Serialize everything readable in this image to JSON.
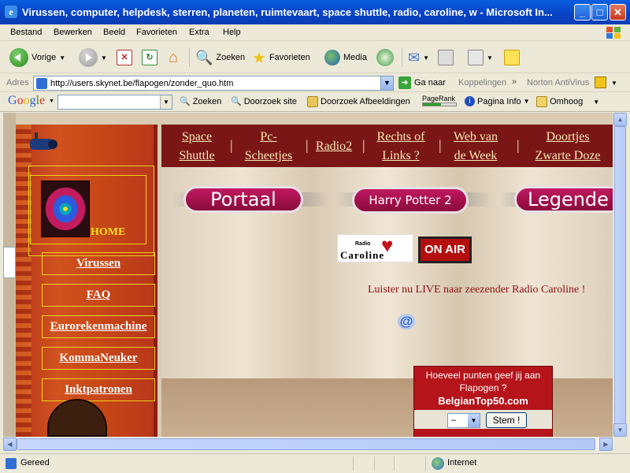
{
  "window": {
    "title": "Virussen, computer, helpdesk, sterren, planeten, ruimtevaart, space shuttle, radio, caroline, w - Microsoft In...",
    "app_icon": "ie-icon",
    "buttons": [
      "minimize",
      "maximize",
      "close"
    ]
  },
  "menubar": {
    "items": [
      "Bestand",
      "Bewerken",
      "Beeld",
      "Favorieten",
      "Extra",
      "Help"
    ]
  },
  "toolbar": {
    "back_label": "Vorige",
    "search_label": "Zoeken",
    "favorites_label": "Favorieten",
    "media_label": "Media"
  },
  "address": {
    "label": "Adres",
    "url": "http://users.skynet.be/flapogen/zonder_quo.htm",
    "go_label": "Ga naar",
    "links_label": "Koppelingen",
    "norton_label": "Norton AntiVirus"
  },
  "google": {
    "logo": "Google",
    "search_value": "",
    "zoeken_label": "Zoeken",
    "doorzoek_site_label": "Doorzoek site",
    "doorzoek_afb_label": "Doorzoek Afbeeldingen",
    "pagerank_label": "PageRank",
    "pagina_info_label": "Pagina Info",
    "omhoog_label": "Omhoog"
  },
  "sidebar": {
    "home_label": "HOME",
    "nav": [
      "Virussen",
      "FAQ",
      "Eurorekenmachine",
      "KommaNeuker",
      "Inktpatronen"
    ]
  },
  "topnav": {
    "links": [
      {
        "line1": "Space",
        "line2": "Shuttle"
      },
      {
        "line1": "Pc-",
        "line2": "Scheetjes"
      },
      {
        "line1": "Radio2",
        "line2": ""
      },
      {
        "line1": "Rechts of",
        "line2": "Links ?"
      },
      {
        "line1": "Web van",
        "line2": "de Week"
      },
      {
        "line1": "Doortjes",
        "line2": "Zwarte Doze"
      }
    ]
  },
  "banners": {
    "portaal": "Portaal",
    "harry_potter": "Harry Potter 2",
    "legende": "Legende"
  },
  "radio": {
    "logo_small": "Radio",
    "logo_big": "Caroline",
    "on_air": "ON AIR",
    "live_text": "Luister nu LIVE naar zeezender Radio Caroline !"
  },
  "vote": {
    "question": "Hoeveel punten geef jij aan Flapogen ?",
    "site": "BelgianTop50.com",
    "select_value": "–",
    "submit_label": "Stem !"
  },
  "status": {
    "text": "Gereed",
    "zone": "Internet"
  }
}
